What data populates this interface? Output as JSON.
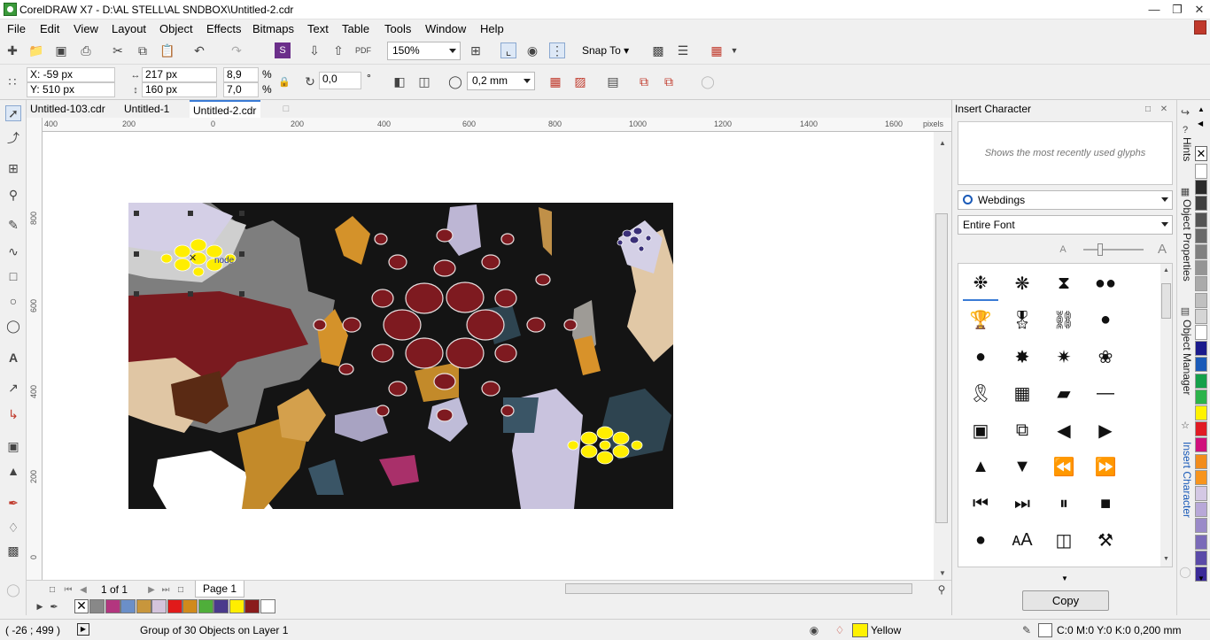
{
  "window": {
    "title": "CorelDRAW X7 - D:\\AL STELL\\AL SNDBOX\\Untitled-2.cdr"
  },
  "menu": [
    "File",
    "Edit",
    "View",
    "Layout",
    "Object",
    "Effects",
    "Bitmaps",
    "Text",
    "Table",
    "Tools",
    "Window",
    "Help"
  ],
  "toolbar": {
    "zoom": "150%",
    "snap_label": "Snap To"
  },
  "props": {
    "x": "X: -59 px",
    "y": "Y: 510 px",
    "w": "217 px",
    "h": "160 px",
    "sx": "8,9",
    "sy": "7,0",
    "pct1": "%",
    "pct2": "%",
    "angle": "0,0",
    "deg": "°",
    "outline": "0,2 mm"
  },
  "tabs": [
    "Untitled-103.cdr",
    "Untitled-1",
    "Untitled-2.cdr"
  ],
  "hruler": {
    "unit": "pixels",
    "ticks": [
      "400",
      "200",
      "0",
      "200",
      "400",
      "600",
      "800",
      "1000",
      "1200",
      "1400",
      "1600"
    ]
  },
  "vruler": {
    "ticks": [
      "800",
      "600",
      "400",
      "200",
      "0",
      "200"
    ],
    "unit": "pixels"
  },
  "canvas": {
    "node_label": "node"
  },
  "pagebar": {
    "counter": "1 of 1",
    "page": "Page 1"
  },
  "palette": {
    "colors": [
      "#888888",
      "#b3367f",
      "#6b8fc8",
      "#c8963c",
      "#d4c4dc",
      "#e11a1a",
      "#d08a1c",
      "#4fae3a",
      "#4a3a8c",
      "#ffee00",
      "#8a1c1c",
      "#ffffff"
    ]
  },
  "status": {
    "coords": "( -26  ; 499 )",
    "selection": "Group of 30 Objects on Layer 1",
    "fill_name": "Yellow",
    "fill_color": "#fff200",
    "outline_info": "C:0 M:0 Y:0 K:0  0,200 mm"
  },
  "docker": {
    "title": "Insert Character",
    "recent_hint": "Shows the most recently used glyphs",
    "font": "Webdings",
    "range": "Entire Font",
    "copy_label": "Copy",
    "glyph_icons": [
      "spider-icon",
      "web-icon",
      "spiral-icon",
      "sunglasses-icon",
      "trophy-icon",
      "medal-icon",
      "chain-icon",
      "speech-bubble-icon",
      "speech-bubble-left-icon",
      "burst-icon",
      "explosion-icon",
      "chili-icon",
      "ribbon-icon",
      "checker-icon",
      "parallelogram-icon",
      "underscore-icon",
      "window-icon",
      "windows-icon",
      "triangle-left-icon",
      "triangle-right-icon",
      "triangle-up-icon",
      "triangle-down-icon",
      "rewind-icon",
      "fast-forward-icon",
      "skip-back-icon",
      "skip-forward-icon",
      "pause-icon",
      "stop-icon",
      "record-icon",
      "font-size-icon",
      "package-icon",
      "tools-icon"
    ]
  },
  "sidetabs": [
    "Hints",
    "Object Properties",
    "Object Manager",
    "Insert Character"
  ],
  "rightpalette": [
    "#ffffff",
    "#2a2a2a",
    "#3f3f3f",
    "#555555",
    "#6a6a6a",
    "#808080",
    "#959595",
    "#aaaaaa",
    "#c0c0c0",
    "#d5d5d5",
    "#ffffff",
    "#1a1a8c",
    "#1a5ab8",
    "#14a04a",
    "#2cb34a",
    "#fff200",
    "#e01b24",
    "#d0107c",
    "#f28c1c",
    "#f7941d",
    "#d4c8e4",
    "#b8a8d8",
    "#9a8ac8",
    "#7a6ab8",
    "#5a4aa8",
    "#3a2a98"
  ]
}
